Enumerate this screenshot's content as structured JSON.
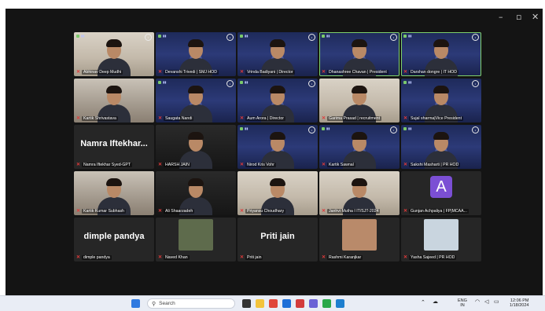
{
  "window": {
    "controls": {
      "minimize": "–",
      "maximize": "▫",
      "close": "✕"
    }
  },
  "tiles": [
    {
      "name": "Abhinav Deep Mudhi",
      "kind": "video",
      "tone": "light",
      "icons": true,
      "active": false
    },
    {
      "name": "Devanshi Trivedi | SMJ HOD",
      "kind": "video",
      "tone": "bluebg",
      "icons": true,
      "active": false
    },
    {
      "name": "Vrinda Badiyani | Director",
      "kind": "video",
      "tone": "bluebg",
      "icons": true,
      "active": false
    },
    {
      "name": "Dhanashree Chavan | President",
      "kind": "video",
      "tone": "bluebg",
      "icons": true,
      "active": true
    },
    {
      "name": "Darshan dongre | IT HOD",
      "kind": "video",
      "tone": "bluebg",
      "icons": true,
      "active": true
    },
    {
      "name": "Kartik Shrivastava",
      "kind": "video",
      "tone": "room",
      "icons": false,
      "active": false
    },
    {
      "name": "Saugata Nandi",
      "kind": "video",
      "tone": "bluebg",
      "icons": true,
      "active": false
    },
    {
      "name": "Aum Arora | Director",
      "kind": "video",
      "tone": "bluebg",
      "icons": true,
      "active": false
    },
    {
      "name": "Garima Prasad | recruitment",
      "kind": "video",
      "tone": "light",
      "icons": false,
      "active": false
    },
    {
      "name": "Sujal sharma|Vice President",
      "kind": "video",
      "tone": "bluebg",
      "icons": true,
      "active": false
    },
    {
      "name": "Namra Iftekhar Syed-GPT",
      "kind": "name",
      "display": "Namra  Iftekhar...",
      "active": false
    },
    {
      "name": "HARSH JAIN",
      "kind": "video",
      "tone": "dark",
      "icons": false,
      "active": false
    },
    {
      "name": "Nirod Kris Vohr",
      "kind": "video",
      "tone": "bluebg",
      "icons": true,
      "active": false
    },
    {
      "name": "Kartik Sawnal",
      "kind": "video",
      "tone": "bluebg",
      "icons": true,
      "active": false
    },
    {
      "name": "Sakshi Masharti | PR HOD",
      "kind": "video",
      "tone": "bluebg",
      "icons": true,
      "active": false
    },
    {
      "name": "Kartik Kumar Subhash",
      "kind": "video",
      "tone": "room",
      "icons": false,
      "active": false
    },
    {
      "name": "Ali Shaarzadeh",
      "kind": "video",
      "tone": "dark",
      "icons": false,
      "active": false
    },
    {
      "name": "Priyansu Choudhary",
      "kind": "video",
      "tone": "light",
      "icons": false,
      "active": false
    },
    {
      "name": "Janhvi Mutha I IT/SJT-2024",
      "kind": "video",
      "tone": "light",
      "icons": false,
      "active": false
    },
    {
      "name": "Gunjan Achpaliya | FP|MCAA...",
      "kind": "avatar",
      "initial": "A",
      "active": false
    },
    {
      "name": "dimple pandya",
      "kind": "name",
      "display": "dimple pandya",
      "active": false
    },
    {
      "name": "Naved Khan",
      "kind": "thumb",
      "color": "#5e6b4c",
      "active": false
    },
    {
      "name": "Priti jain",
      "kind": "name",
      "display": "Priti jain",
      "active": false
    },
    {
      "name": "Rashmi Karanjkar",
      "kind": "thumb",
      "color": "#b98a6a",
      "active": false
    },
    {
      "name": "Yasha Sajeed | PR HOD",
      "kind": "thumb",
      "color": "#c9d5df",
      "active": false
    }
  ],
  "taskbar": {
    "search_label": "Search",
    "search_icon": "search-icon",
    "apps": [
      {
        "icon": "windows-start-icon",
        "color": "#2f7ae0"
      },
      {
        "icon": "task-view-icon",
        "color": "#333333"
      },
      {
        "icon": "file-explorer-icon",
        "color": "#f3c33c"
      },
      {
        "icon": "chrome-icon",
        "color": "#e0463a"
      },
      {
        "icon": "app-blue-icon",
        "color": "#1d6fd8"
      },
      {
        "icon": "app-red-icon",
        "color": "#d33c3c"
      },
      {
        "icon": "teams-icon",
        "color": "#6b62d6"
      },
      {
        "icon": "app-green-icon",
        "color": "#2aa84a"
      },
      {
        "icon": "edge-icon",
        "color": "#1e7fcf"
      }
    ],
    "tray": {
      "lang": "ENG",
      "region": "IN",
      "time": "12:06 PM",
      "date": "1/18/2024"
    }
  }
}
